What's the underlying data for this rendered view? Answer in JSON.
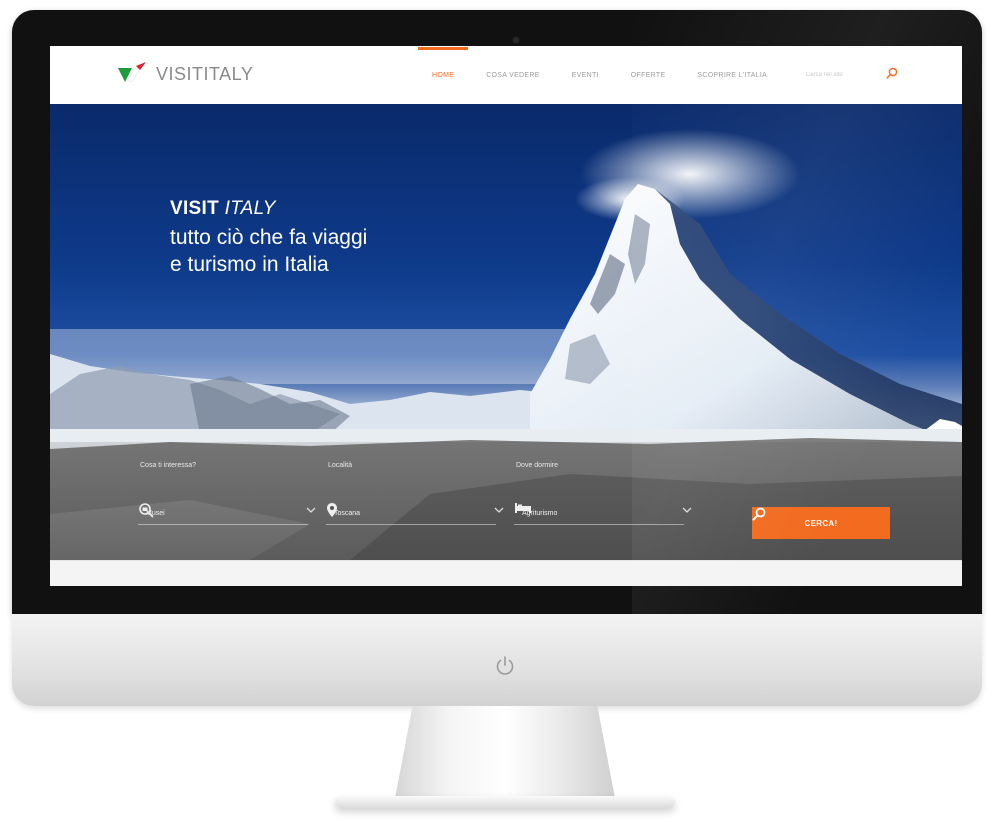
{
  "header": {
    "logo_text": "VISITITALY",
    "nav": [
      {
        "label": "HOME",
        "active": true
      },
      {
        "label": "COSA VEDERE",
        "active": false
      },
      {
        "label": "EVENTI",
        "active": false
      },
      {
        "label": "OFFERTE",
        "active": false
      },
      {
        "label": "SCOPRIRE L'ITALIA",
        "active": false
      }
    ],
    "search_placeholder": "Cerca nel sito"
  },
  "hero": {
    "title_bold": "VISIT",
    "title_italic": "ITALY",
    "subtitle_line1": "tutto ciò che fa viaggi",
    "subtitle_line2": "e turismo in Italia"
  },
  "search_form": {
    "interest_label": "Cosa ti interessa?",
    "interest_value": "Musei",
    "location_label": "Località",
    "location_value": "Toscana",
    "stay_label": "Dove dormire",
    "stay_value": "Agriturismo",
    "submit_label": "CERCA!"
  },
  "colors": {
    "accent": "#f26b1f",
    "logo_green": "#1e9b3c",
    "logo_red": "#d8232a"
  },
  "icons": [
    "search-icon",
    "map-pin-icon",
    "bed-icon",
    "museum-search-icon",
    "chevron-down-icon",
    "power-icon"
  ]
}
